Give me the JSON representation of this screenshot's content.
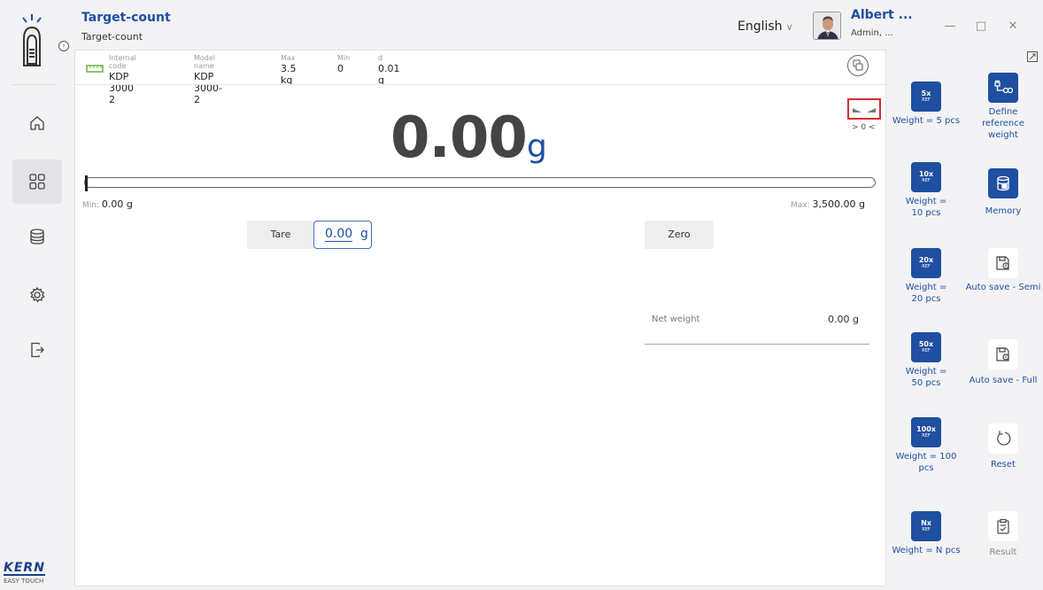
{
  "nav": {
    "items": [
      {
        "name": "home-icon"
      },
      {
        "name": "apps-icon"
      },
      {
        "name": "database-icon"
      },
      {
        "name": "gear-icon"
      },
      {
        "name": "exit-icon"
      }
    ],
    "brand": "KERN",
    "brand_sub": "EASY TOUCH"
  },
  "header": {
    "title": "Target-count",
    "subtitle": "Target-count",
    "language": "English",
    "user_name": "Albert ...",
    "user_role": "Admin, ..."
  },
  "info": {
    "internal_code_label": "Internal code",
    "internal_code": "KDP 3000 2",
    "model_label": "Model name",
    "model": "KDP 3000-2",
    "max_label": "Max",
    "max": "3.5 kg",
    "min_label": "Min",
    "min": "0",
    "d_label": "d",
    "d": "0.01 g"
  },
  "display": {
    "weight": "0.00",
    "unit": "g",
    "zero_indicator": "> 0 <",
    "min_label": "Min:",
    "min_value": "0.00 g",
    "max_label": "Max:",
    "max_value": "3,500.00 g",
    "fill_fraction": 0
  },
  "controls": {
    "tare_label": "Tare",
    "tare_value": "0.00",
    "tare_unit": "g",
    "zero_label": "Zero",
    "net_weight_label": "Net weight",
    "net_weight_value": "0.00 g"
  },
  "functions": [
    {
      "icon_t1": "5x",
      "icon_t2": "REF",
      "label": "Weight = 5 pcs",
      "style": "blue"
    },
    {
      "icon_name": "define-reference-icon",
      "label": "Define reference weight",
      "style": "blue"
    },
    {
      "icon_t1": "10x",
      "icon_t2": "REF",
      "label": "Weight = 10 pcs",
      "style": "blue"
    },
    {
      "icon_name": "memory-icon",
      "label": "Memory",
      "style": "blue"
    },
    {
      "icon_t1": "20x",
      "icon_t2": "REF",
      "label": "Weight = 20 pcs",
      "style": "blue"
    },
    {
      "icon_name": "auto-save-semi-icon",
      "label": "Auto save - Semi",
      "style": "white"
    },
    {
      "icon_t1": "50x",
      "icon_t2": "REF",
      "label": "Weight = 50 pcs",
      "style": "blue"
    },
    {
      "icon_name": "auto-save-full-icon",
      "label": "Auto save - Full",
      "style": "white"
    },
    {
      "icon_t1": "100x",
      "icon_t2": "REF",
      "label": "Weight = 100 pcs",
      "style": "blue"
    },
    {
      "icon_name": "reset-icon",
      "label": "Reset",
      "style": "white"
    },
    {
      "icon_t1": "Nx",
      "icon_t2": "REF",
      "label": "Weight = N pcs",
      "style": "blue"
    },
    {
      "icon_name": "result-icon",
      "label": "Result",
      "style": "white-disabled"
    }
  ],
  "colors": {
    "accent": "#1f4fa0",
    "alert": "#d32f2f"
  }
}
